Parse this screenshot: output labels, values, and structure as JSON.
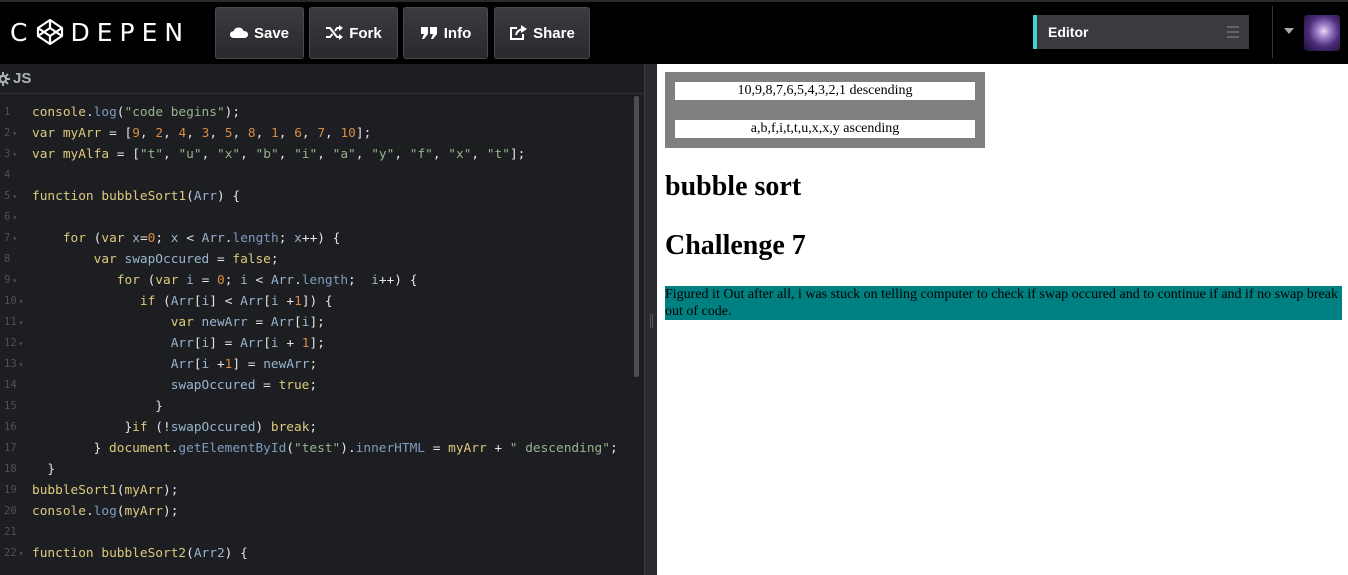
{
  "header": {
    "logo_text": "CODEPEN",
    "buttons": {
      "save": "Save",
      "fork": "Fork",
      "info": "Info",
      "share": "Share"
    },
    "view_switch": "Editor",
    "accent_color": "#47cfd8"
  },
  "js_pane": {
    "title": "JS",
    "code_lines": [
      {
        "n": "1",
        "fold": false,
        "text": "console.log(\"code begins\");"
      },
      {
        "n": "2",
        "fold": true,
        "text": "var myArr = [9, 2, 4, 3, 5, 8, 1, 6, 7, 10];"
      },
      {
        "n": "3",
        "fold": true,
        "text": "var myAlfa = [\"t\", \"u\", \"x\", \"b\", \"i\", \"a\", \"y\", \"f\", \"x\", \"t\"];"
      },
      {
        "n": "4",
        "fold": false,
        "text": ""
      },
      {
        "n": "5",
        "fold": true,
        "text": "function bubbleSort1(Arr) {"
      },
      {
        "n": "6",
        "fold": true,
        "text": ""
      },
      {
        "n": "7",
        "fold": true,
        "text": "    for (var x=0; x < Arr.length; x++) {"
      },
      {
        "n": "8",
        "fold": false,
        "text": "        var swapOccured = false;"
      },
      {
        "n": "9",
        "fold": true,
        "text": "           for (var i = 0; i < Arr.length;  i++) {"
      },
      {
        "n": "10",
        "fold": true,
        "text": "              if (Arr[i] < Arr[i +1]) {"
      },
      {
        "n": "11",
        "fold": true,
        "text": "                  var newArr = Arr[i];"
      },
      {
        "n": "12",
        "fold": true,
        "text": "                  Arr[i] = Arr[i + 1];"
      },
      {
        "n": "13",
        "fold": true,
        "text": "                  Arr[i +1] = newArr;"
      },
      {
        "n": "14",
        "fold": false,
        "text": "                  swapOccured = true;"
      },
      {
        "n": "15",
        "fold": false,
        "text": "                }"
      },
      {
        "n": "16",
        "fold": false,
        "text": "            }if (!swapOccured) break;"
      },
      {
        "n": "17",
        "fold": false,
        "text": "        } document.getElementById(\"test\").innerHTML = myArr + \" descending\";"
      },
      {
        "n": "18",
        "fold": false,
        "text": "  }"
      },
      {
        "n": "19",
        "fold": false,
        "text": "bubbleSort1(myArr);"
      },
      {
        "n": "20",
        "fold": false,
        "text": "console.log(myArr);"
      },
      {
        "n": "21",
        "fold": false,
        "text": ""
      },
      {
        "n": "22",
        "fold": true,
        "text": "function bubbleSort2(Arr2) {"
      }
    ]
  },
  "preview": {
    "result_descending": "10,9,8,7,6,5,4,3,2,1 descending",
    "result_ascending": "a,b,f,i,t,t,u,x,x,y ascending",
    "heading_1": "bubble sort",
    "heading_2": "Challenge 7",
    "note": "Figured it Out after all, i was stuck on telling computer to check if swap occured and to continue if and if no swap break out of code.",
    "note_bg": "#008080"
  }
}
